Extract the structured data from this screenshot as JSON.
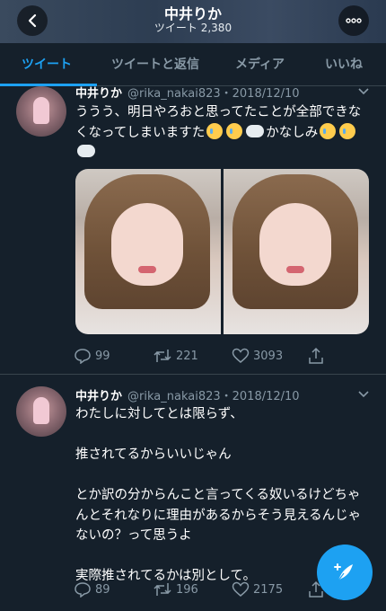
{
  "header": {
    "title": "中井りか",
    "tweet_count": "ツイート 2,380"
  },
  "tabs": [
    "ツイート",
    "ツイートと返信",
    "メディア",
    "いいね"
  ],
  "tweets": [
    {
      "name": "中井りか",
      "handle": "@rika_nakai823",
      "date": "・2018/12/10",
      "text_part1": "ううう、明日やろおと思ってたことが全部できなくなってしまいますた",
      "text_part2": "かなしみ",
      "replies": "99",
      "retweets": "221",
      "likes": "3093"
    },
    {
      "name": "中井りか",
      "handle": "@rika_nakai823",
      "date": "・2018/12/10",
      "lines": [
        "わたしに対してとは限らず、",
        "",
        "推されてるからいいじゃん",
        "",
        "とか訳の分からんこと言ってくる奴いるけどちゃんとそれなりに理由があるからそう見えるんじゃないの？って思うよ",
        "",
        "実際推されてるかは別として。"
      ],
      "replies": "89",
      "retweets": "196",
      "likes": "2175"
    }
  ]
}
